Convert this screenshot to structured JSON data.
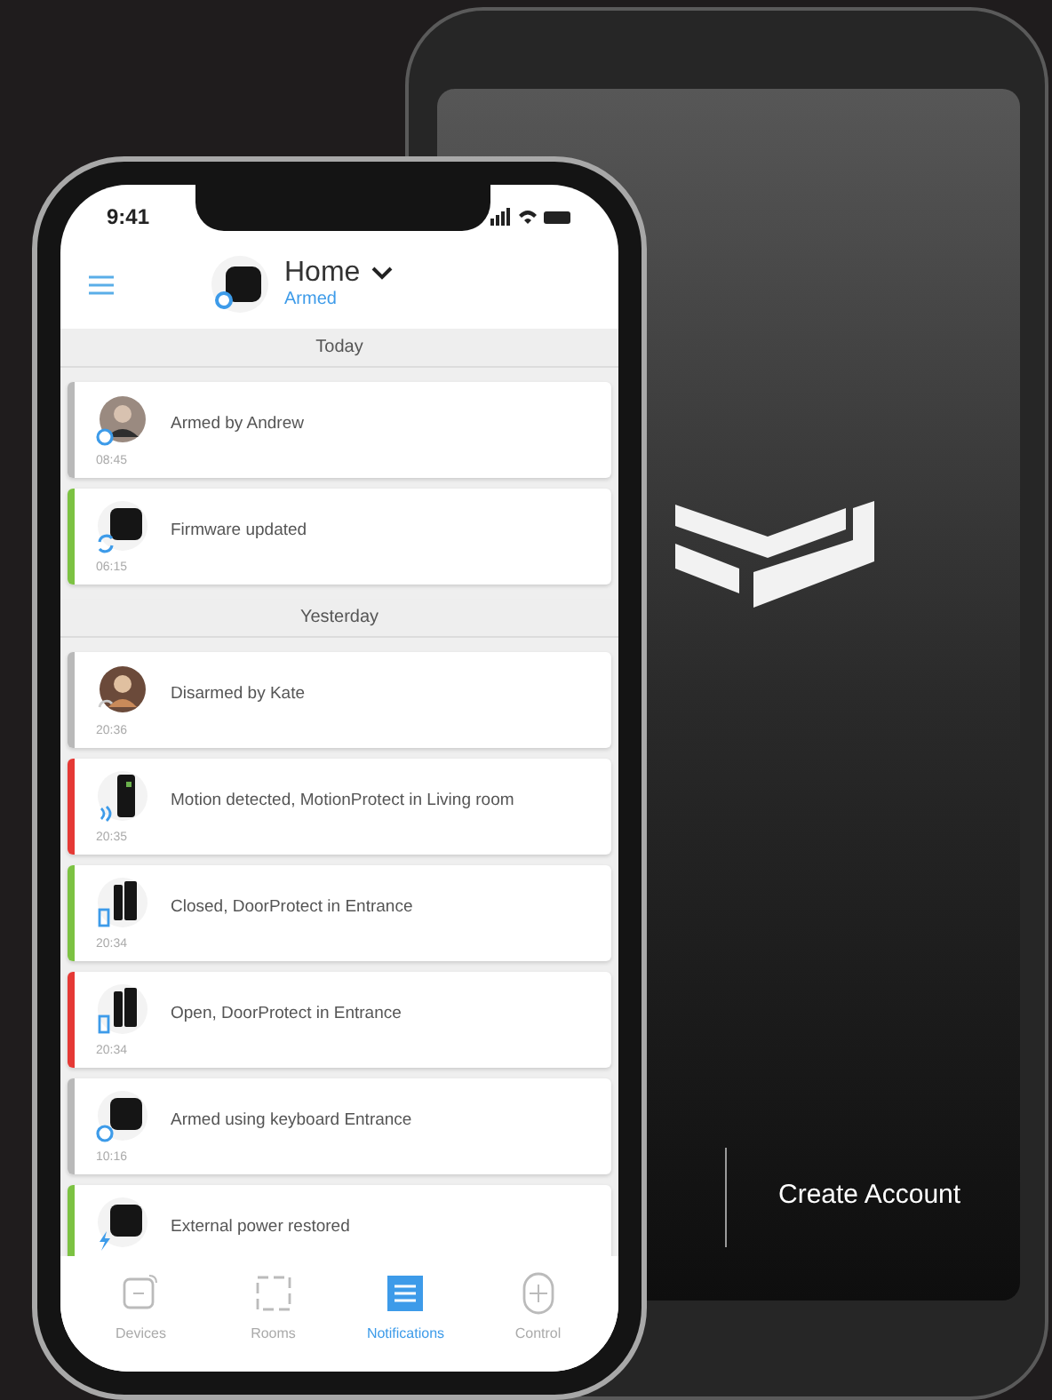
{
  "status_bar": {
    "time": "9:41"
  },
  "header": {
    "title": "Home",
    "status": "Armed"
  },
  "sections": [
    {
      "title": "Today",
      "items": [
        {
          "kind": "user-armed",
          "text": "Armed by Andrew",
          "time": "08:45",
          "color": "#b9b9b9"
        },
        {
          "kind": "hub-update",
          "text": "Firmware updated",
          "time": "06:15",
          "color": "#7cc242"
        }
      ]
    },
    {
      "title": "Yesterday",
      "items": [
        {
          "kind": "user-disarmed",
          "text": "Disarmed by Kate",
          "time": "20:36",
          "color": "#b9b9b9"
        },
        {
          "kind": "motion",
          "text": "Motion detected, MotionProtect in Living room",
          "time": "20:35",
          "color": "#e53935"
        },
        {
          "kind": "door",
          "text": "Closed, DoorProtect in Entrance",
          "time": "20:34",
          "color": "#7cc242"
        },
        {
          "kind": "door",
          "text": "Open, DoorProtect in Entrance",
          "time": "20:34",
          "color": "#e53935"
        },
        {
          "kind": "hub-armed",
          "text": "Armed using keyboard Entrance",
          "time": "10:16",
          "color": "#b9b9b9"
        },
        {
          "kind": "hub-power",
          "text": "External power restored",
          "color": "#7cc242"
        }
      ]
    }
  ],
  "tabs": [
    {
      "label": "Devices",
      "selected": false
    },
    {
      "label": "Rooms",
      "selected": false
    },
    {
      "label": "Notifications",
      "selected": true
    },
    {
      "label": "Control",
      "selected": false
    }
  ],
  "back_phone": {
    "button": "Create Account"
  }
}
